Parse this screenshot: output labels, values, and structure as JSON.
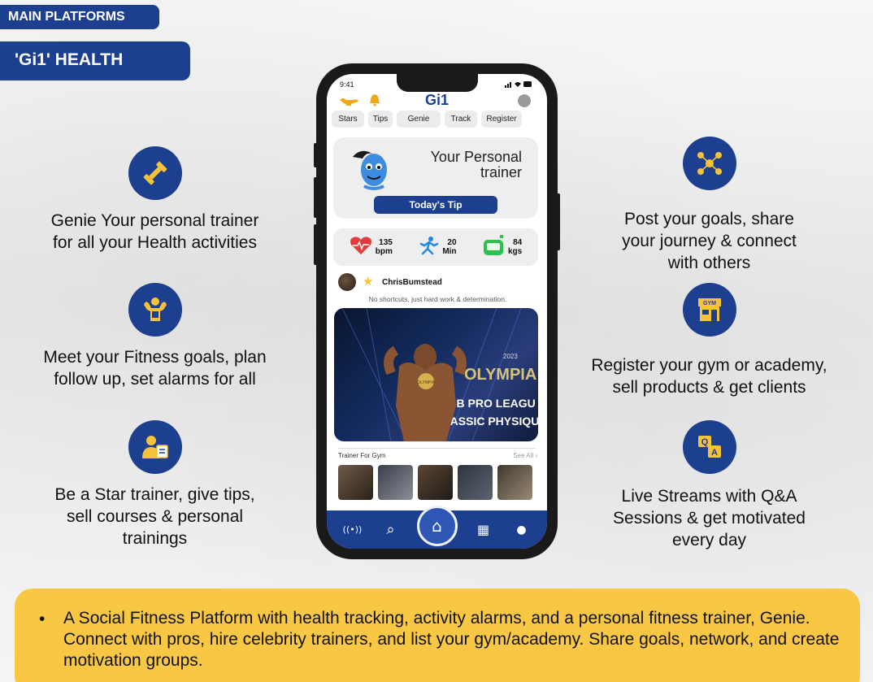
{
  "tags": {
    "main": "MAIN PLATFORMS",
    "health": "'Gi1' HEALTH"
  },
  "features": {
    "left": [
      {
        "icon": "dumbbell-icon",
        "lines": [
          "Genie Your personal trainer",
          "for all your Health activities"
        ]
      },
      {
        "icon": "bodybuilder-icon",
        "lines": [
          "Meet your Fitness goals, plan",
          "follow up, set alarms for all"
        ]
      },
      {
        "icon": "trainer-icon",
        "lines": [
          "Be a Star trainer, give tips,",
          "sell courses & personal",
          "trainings"
        ]
      }
    ],
    "right": [
      {
        "icon": "network-icon",
        "lines": [
          "Post your goals, share",
          "your journey & connect",
          "with others"
        ]
      },
      {
        "icon": "gym-icon",
        "icon_text": "GYM",
        "lines": [
          "Register your gym or academy,",
          "sell products & get clients"
        ]
      },
      {
        "icon": "qa-icon",
        "icon_text": [
          "Q",
          "A"
        ],
        "lines": [
          "Live Streams with Q&A",
          "Sessions & get motivated",
          "every day"
        ]
      }
    ]
  },
  "phone": {
    "time": "9:41",
    "app_title": "Gi1",
    "tabs": [
      "Stars",
      "Tips",
      "Genie",
      "Track",
      "Register"
    ],
    "trainer_card": {
      "title_line1": "Your Personal",
      "title_line2": "trainer",
      "button": "Today's Tip"
    },
    "stats": [
      {
        "icon": "heart-rate-icon",
        "value": "135",
        "unit": "bpm",
        "color": "#e23b3b"
      },
      {
        "icon": "runner-icon",
        "value": "20",
        "unit": "Min",
        "color": "#1e88e5"
      },
      {
        "icon": "scale-icon",
        "value": "84",
        "unit": "kgs",
        "color": "#2dbf4f"
      }
    ],
    "post": {
      "user": "ChrisBumstead",
      "caption": "No shortcuts, just hard work & determination.",
      "image_text": {
        "event": "OLYMPIA",
        "year": "2023",
        "line1": "IFBB PRO LEAGU",
        "line2": "CLASSIC PHYSIQU",
        "medal": "OLYMPIA"
      }
    },
    "trainer_section": {
      "label": "Trainer For Gym",
      "see_all": "See All ›"
    },
    "nav": [
      {
        "icon": "live-icon",
        "label": "((•))"
      },
      {
        "icon": "search-icon",
        "label": "⌕"
      },
      {
        "icon": "home-icon",
        "label": "⌂"
      },
      {
        "icon": "gym-building-icon",
        "label": "▦"
      },
      {
        "icon": "profile-icon",
        "label": "●"
      }
    ]
  },
  "banner": {
    "bullet": "•",
    "text": "A Social Fitness Platform with health tracking, activity alarms, and a personal fitness trainer, Genie. Connect with pros, hire celebrity trainers, and list your gym/academy. Share goals, network, and create motivation groups."
  },
  "colors": {
    "brand_blue": "#1d3f8f",
    "banner_yellow": "#f8c845",
    "icon_yellow": "#f6c23a"
  }
}
